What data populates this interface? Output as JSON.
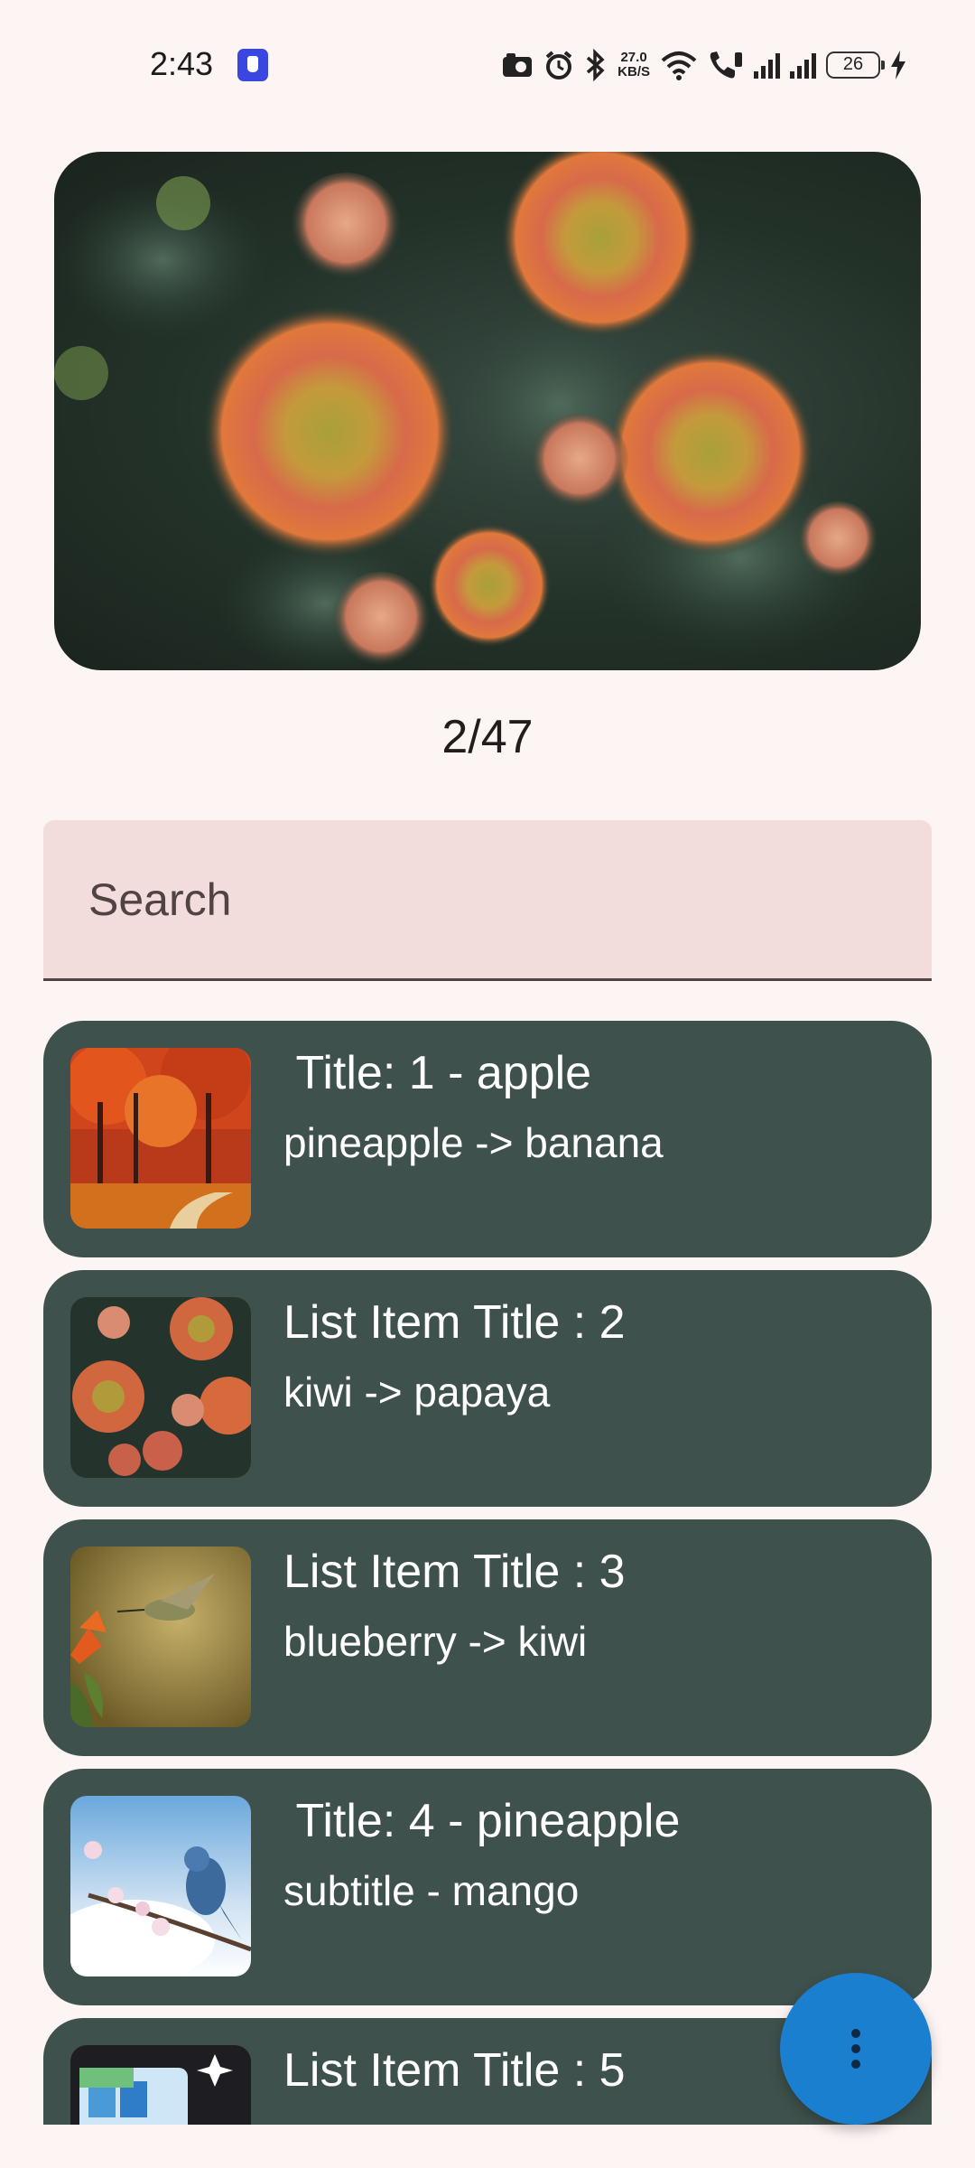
{
  "status_bar": {
    "time": "2:43",
    "net_speed_value": "27.0",
    "net_speed_unit": "KB/S",
    "battery": "26"
  },
  "hero": {
    "counter": "2/47"
  },
  "search": {
    "placeholder": "Search"
  },
  "list": {
    "items": [
      {
        "title": " Title: 1 - apple",
        "subtitle": "pineapple -> banana",
        "thumb": "autumn-trees-image"
      },
      {
        "title": "List Item Title : 2",
        "subtitle": "kiwi -> papaya",
        "thumb": "protea-flowers-image"
      },
      {
        "title": "List Item Title : 3",
        "subtitle": "blueberry -> kiwi",
        "thumb": "hummingbird-image"
      },
      {
        "title": " Title: 4 - pineapple",
        "subtitle": "subtitle - mango",
        "thumb": "bluebird-blossom-image"
      },
      {
        "title": "List Item Title : 5",
        "subtitle": "",
        "thumb": "app-illustration-image"
      }
    ]
  },
  "fab": {
    "icon": "more-vert-icon"
  },
  "colors": {
    "background": "#fdf4f4",
    "list_item_bg": "#3f514c",
    "search_bg": "#f3dcdc",
    "fab": "#1b7fd0"
  }
}
